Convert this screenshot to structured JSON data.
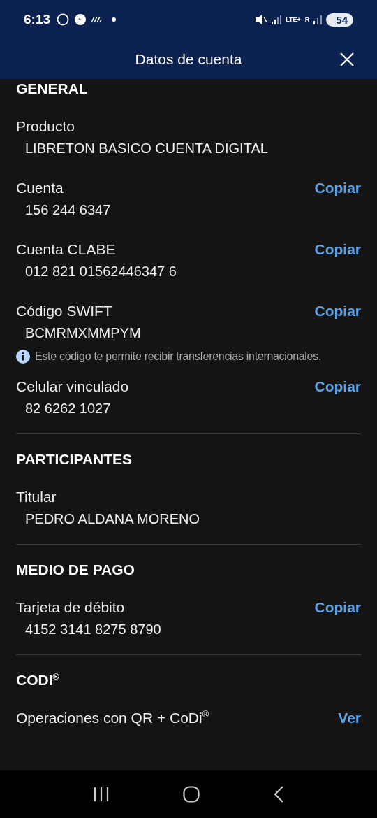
{
  "status_bar": {
    "time": "6:13",
    "network": "LTE+",
    "roaming": "R",
    "battery": "54"
  },
  "header": {
    "title": "Datos de cuenta"
  },
  "sections": [
    {
      "title": "GENERAL",
      "fields": [
        {
          "label": "Producto",
          "value": "LIBRETON BASICO CUENTA DIGITAL"
        },
        {
          "label": "Cuenta",
          "value": "156 244 6347",
          "action": "Copiar"
        },
        {
          "label": "Cuenta CLABE",
          "value": "012 821 01562446347 6",
          "action": "Copiar"
        },
        {
          "label": "Código SWIFT",
          "value": "BCMRMXMMPYM",
          "action": "Copiar",
          "note": "Este código te permite recibir transferencias internacionales."
        },
        {
          "label": "Celular vinculado",
          "value": "82 6262 1027",
          "action": "Copiar"
        }
      ]
    },
    {
      "title": "PARTICIPANTES",
      "fields": [
        {
          "label": "Titular",
          "value": "PEDRO ALDANA MORENO"
        }
      ]
    },
    {
      "title": "MEDIO DE PAGO",
      "fields": [
        {
          "label": "Tarjeta de débito",
          "value": "4152 3141 8275 8790",
          "action": "Copiar"
        }
      ]
    },
    {
      "title": "CODI$^{®}$",
      "fields": [
        {
          "label": "Operaciones con QR + CoDi$^{®}$",
          "action": "Ver"
        }
      ]
    }
  ]
}
